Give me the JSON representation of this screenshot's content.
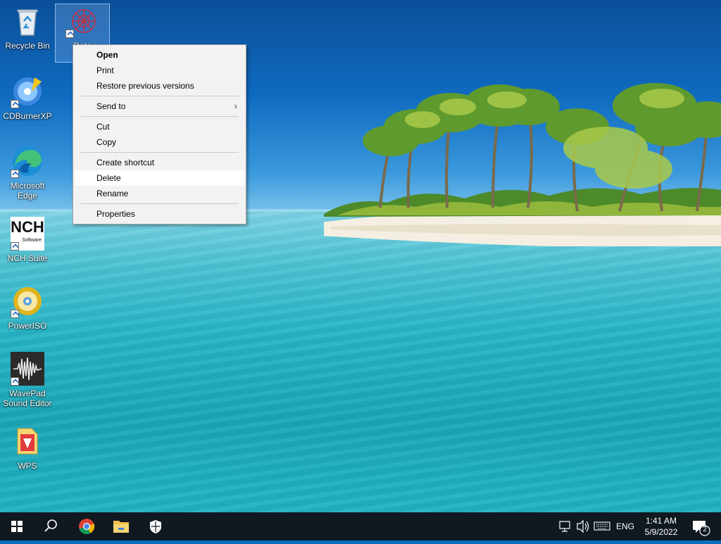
{
  "desktop": {
    "icons": [
      {
        "label": "Recycle Bin",
        "icon": "recycle-bin-icon"
      },
      {
        "label": "Data",
        "icon": "data-app-icon"
      },
      {
        "label": "CDBurnerXP",
        "icon": "cdburnerxp-icon"
      },
      {
        "label": "Microsoft Edge",
        "icon": "edge-icon"
      },
      {
        "label": "NCH Suite",
        "icon": "nch-suite-icon",
        "logo_text": "NCH",
        "logo_sub": "Software"
      },
      {
        "label": "PowerISO",
        "icon": "poweriso-icon"
      },
      {
        "label": "WavePad Sound Editor",
        "icon": "wavepad-icon"
      },
      {
        "label": "WPS",
        "icon": "wps-icon"
      }
    ]
  },
  "context_menu": {
    "items": [
      {
        "label": "Open"
      },
      {
        "label": "Print"
      },
      {
        "label": "Restore previous versions"
      },
      {
        "label": "Send to"
      },
      {
        "label": "Cut"
      },
      {
        "label": "Copy"
      },
      {
        "label": "Create shortcut"
      },
      {
        "label": "Delete"
      },
      {
        "label": "Rename"
      },
      {
        "label": "Properties"
      }
    ],
    "submenu_glyph": "›"
  },
  "taskbar": {
    "start_icon": "windows-start-icon",
    "search_icon": "search-icon",
    "apps": [
      "chrome-icon",
      "file-explorer-icon",
      "windows-security-icon"
    ],
    "tray": {
      "network_icon": "network-icon",
      "volume_icon": "volume-icon",
      "keyboard_icon": "touch-keyboard-icon",
      "language": "ENG",
      "time": "1:41 AM",
      "date": "5/9/2022",
      "notification_count": "2"
    }
  },
  "colors": {
    "taskbar_bg": "#101820",
    "menu_bg": "#f2f2f2",
    "accent": "#0078d7"
  }
}
